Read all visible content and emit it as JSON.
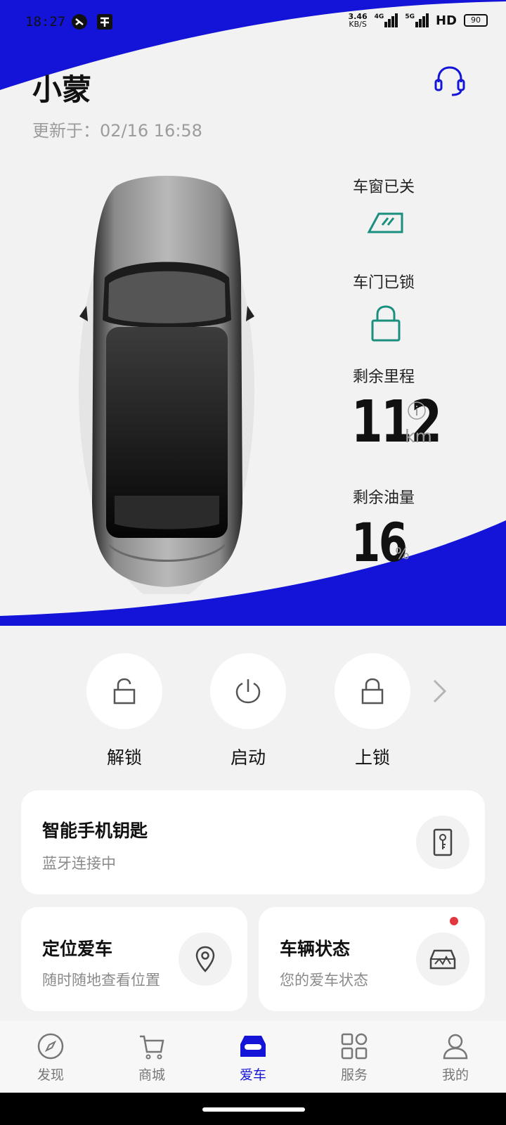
{
  "status_bar": {
    "time": "18:27",
    "net_speed": "3.46",
    "net_speed_unit": "KB/S",
    "signal1_label": "4G",
    "signal2_label": "5G",
    "hd_label": "HD",
    "battery": "90"
  },
  "header": {
    "title": "小蒙",
    "update_time": "更新于：02/16 16:58"
  },
  "vehicle_status": {
    "window_label": "车窗已关",
    "door_label": "车门已锁",
    "range_label": "剩余里程",
    "range_value": "112",
    "range_unit": "km",
    "fuel_label": "剩余油量",
    "fuel_value": "16",
    "fuel_unit": "%"
  },
  "quick_actions": [
    {
      "label": "解锁",
      "icon": "unlock-icon"
    },
    {
      "label": "启动",
      "icon": "power-icon"
    },
    {
      "label": "上锁",
      "icon": "lock-icon"
    }
  ],
  "cards": {
    "smart_key": {
      "title": "智能手机钥匙",
      "subtitle": "蓝牙连接中",
      "icon": "phone-key-icon"
    },
    "locate": {
      "title": "定位爱车",
      "subtitle": "随时随地查看位置",
      "icon": "location-pin-icon"
    },
    "vehicle_state": {
      "title": "车辆状态",
      "subtitle": "您的爱车状态",
      "icon": "car-status-icon"
    }
  },
  "bottom_nav": [
    {
      "label": "发现",
      "icon": "compass-icon",
      "active": false
    },
    {
      "label": "商城",
      "icon": "cart-icon",
      "active": false
    },
    {
      "label": "爱车",
      "icon": "car-icon",
      "active": true
    },
    {
      "label": "服务",
      "icon": "grid-icon",
      "active": false
    },
    {
      "label": "我的",
      "icon": "user-icon",
      "active": false
    }
  ],
  "colors": {
    "brand_blue": "#1414d8",
    "accent_green": "#1a8f7e",
    "notify_red": "#e0383e"
  }
}
